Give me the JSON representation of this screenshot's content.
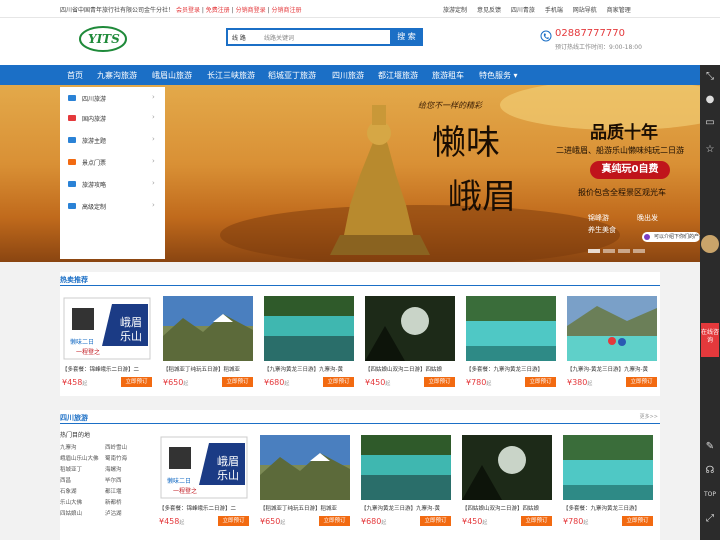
{
  "topbar": {
    "company": "四川省中国青年旅行社有限公司金牛分社！",
    "links": [
      "会员登录",
      "免费注册",
      "分销商登录",
      "分销商注册"
    ],
    "right": [
      "旅游定制",
      "意见反馈",
      "四川青旅",
      "手机端",
      "网站导航",
      "商家管理"
    ]
  },
  "search": {
    "select": "线 路",
    "placeholder": "线路关键词",
    "button": "搜 索"
  },
  "phone": {
    "number": "02887777770",
    "hours": "预订热线工作时间：9:00-18:00"
  },
  "nav": [
    "首页",
    "九寨沟旅游",
    "峨眉山旅游",
    "长江三峡旅游",
    "稻城亚丁旅游",
    "四川旅游",
    "都江堰旅游",
    "旅游租车",
    "特色服务 ▾"
  ],
  "menu": [
    "四川旅游",
    "国内旅游",
    "旅游主题",
    "景点门票",
    "旅游攻略",
    "高级定制"
  ],
  "banner": {
    "tagline": "给您不一样的精彩",
    "title1": "懒味",
    "title2": "峨眉",
    "quality": "品质十年",
    "sub": "二进峨眉、船游乐山懒味纯玩二日游",
    "tag": "真纯玩0自费",
    "note": "报价包含全程景区观光车",
    "features": [
      "锦峰游",
      "晚出发",
      "养生美食"
    ],
    "chat": "可以介绍下你们的产品么"
  },
  "hot": {
    "title": "热卖推荐",
    "cards": [
      {
        "caption": "【多套餐：锦峰峨乐二日游】二",
        "price": "¥458",
        "unit": "起",
        "book": "立即预订"
      },
      {
        "caption": "【稻城亚丁纯玩五日游】稻城亚",
        "price": "¥650",
        "unit": "起",
        "book": "立即预订"
      },
      {
        "caption": "【九寨沟黄龙三日游】九寨沟-黄",
        "price": "¥680",
        "unit": "起",
        "book": "立即预订"
      },
      {
        "caption": "【四姑娘山双沟二日游】四姑娘",
        "price": "¥450",
        "unit": "起",
        "book": "立即预订"
      },
      {
        "caption": "【多套餐：九寨沟黄龙三日游】",
        "price": "¥780",
        "unit": "起",
        "book": "立即预订"
      },
      {
        "caption": "【九寨沟-黄龙三日游】九寨沟-黄",
        "price": "¥380",
        "unit": "起",
        "book": "立即预订"
      }
    ]
  },
  "sichuan": {
    "title": "四川旅游",
    "more": "更多>>",
    "hot_label": "热门目的地",
    "destinations": [
      "九寨沟",
      "西岭雪山",
      "峨眉山乐山大佛",
      "蜀南竹海",
      "稻城亚丁",
      "海螺沟",
      "西昌",
      "毕尔西",
      "石象湖",
      "都江堰",
      "乐山大佛",
      "新都桥",
      "四姑娘山",
      "泸沽湖",
      "水精湾",
      "青城山"
    ],
    "cards": [
      {
        "caption": "【多套餐：锦峰峨乐二日游】二",
        "price": "¥458",
        "unit": "起",
        "book": "立即预订"
      },
      {
        "caption": "【稻城亚丁纯玩五日游】稻城亚",
        "price": "¥650",
        "unit": "起",
        "book": "立即预订"
      },
      {
        "caption": "【九寨沟黄龙三日游】九寨沟-黄",
        "price": "¥680",
        "unit": "起",
        "book": "立即预订"
      },
      {
        "caption": "【四姑娘山双沟二日游】四姑娘",
        "price": "¥450",
        "unit": "起",
        "book": "立即预订"
      },
      {
        "caption": "【多套餐：九寨沟黄龙三日游】",
        "price": "¥780",
        "unit": "起",
        "book": "立即预订"
      }
    ]
  },
  "side": {
    "service": "在线咨询",
    "top": "TOP"
  },
  "poster": {
    "l1": "峨眉",
    "l2": "乐山",
    "l3": "懒味",
    "l4": "二日",
    "l5": "一程",
    "l6": "登之"
  }
}
